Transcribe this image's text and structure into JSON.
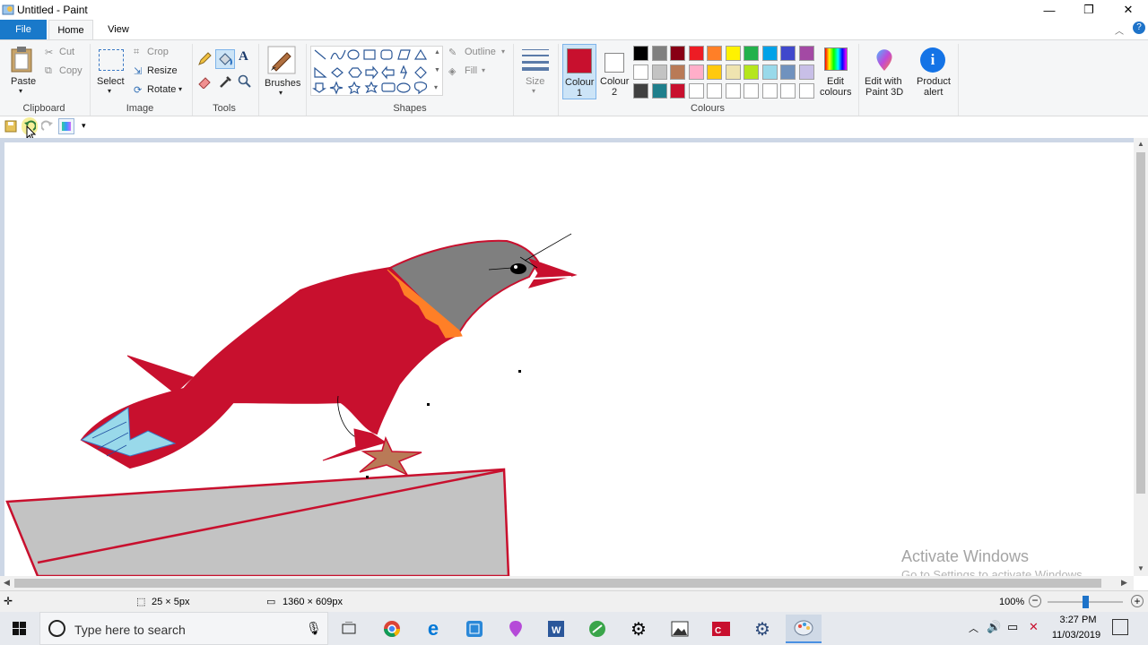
{
  "window": {
    "title": "Untitled - Paint",
    "controls": {
      "minimize": "—",
      "maximize": "❐",
      "close": "✕"
    }
  },
  "tabs": {
    "file": "File",
    "home": "Home",
    "view": "View"
  },
  "ribbon": {
    "clipboard": {
      "paste": "Paste",
      "cut": "Cut",
      "copy": "Copy",
      "group": "Clipboard"
    },
    "image": {
      "select": "Select",
      "crop": "Crop",
      "resize": "Resize",
      "rotate": "Rotate",
      "group": "Image"
    },
    "tools": {
      "group": "Tools"
    },
    "brushes": {
      "label": "Brushes"
    },
    "shapes": {
      "outline": "Outline",
      "fill": "Fill",
      "group": "Shapes"
    },
    "size": {
      "label": "Size"
    },
    "colours": {
      "colour1_line1": "Colour",
      "colour1_line2": "1",
      "colour2_line1": "Colour",
      "colour2_line2": "2",
      "edit_line1": "Edit",
      "edit_line2": "colours",
      "group": "Colours",
      "colour1_value": "#c8102e",
      "colour2_value": "#ffffff"
    },
    "paint3d": {
      "line1": "Edit with",
      "line2": "Paint 3D"
    },
    "alert": {
      "line1": "Product",
      "line2": "alert"
    }
  },
  "palette": {
    "row1": [
      "#000000",
      "#7f7f7f",
      "#880015",
      "#ed1c24",
      "#ff7f27",
      "#fff200",
      "#22b14c",
      "#00a2e8",
      "#3f48cc",
      "#a349a4"
    ],
    "row2": [
      "#ffffff",
      "#c3c3c3",
      "#b97a57",
      "#ffaec9",
      "#ffc90e",
      "#efe4b0",
      "#b5e61d",
      "#99d9ea",
      "#7092be",
      "#c8bfe7"
    ],
    "row3": [
      "#404040",
      "#1f7f8c",
      "#c8102e",
      "#ffffff",
      "#ffffff",
      "#ffffff",
      "#ffffff",
      "#ffffff",
      "#ffffff",
      "#ffffff"
    ]
  },
  "watermark": {
    "line1": "Activate Windows",
    "line2": "Go to Settings to activate Windows."
  },
  "status": {
    "selection": "25 × 5px",
    "canvas_size": "1360 × 609px",
    "zoom": "100%"
  },
  "taskbar": {
    "search_placeholder": "Type here to search",
    "time": "3:27 PM",
    "date": "11/03/2019"
  }
}
